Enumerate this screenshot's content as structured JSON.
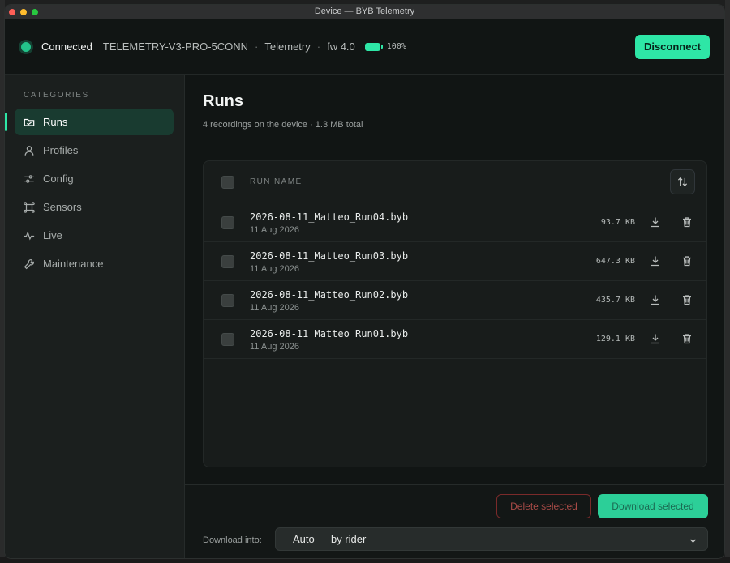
{
  "window": {
    "title": "Device — BYB Telemetry"
  },
  "header": {
    "status": "Connected",
    "device_name": "TELEMETRY-V3-PRO-5CONN",
    "separator": "·",
    "mode": "Telemetry",
    "firmware": "fw 4.0",
    "battery_percent": "100%",
    "battery_level": 1.0,
    "disconnect_label": "Disconnect"
  },
  "sidebar": {
    "heading": "CATEGORIES",
    "items": [
      {
        "label": "Runs",
        "icon": "folder-icon",
        "active": true
      },
      {
        "label": "Profiles",
        "icon": "user-icon",
        "active": false
      },
      {
        "label": "Config",
        "icon": "sliders-icon",
        "active": false
      },
      {
        "label": "Sensors",
        "icon": "sensors-icon",
        "active": false
      },
      {
        "label": "Live",
        "icon": "pulse-icon",
        "active": false
      },
      {
        "label": "Maintenance",
        "icon": "wrench-icon",
        "active": false
      }
    ]
  },
  "main": {
    "title": "Runs",
    "subtitle": "4 recordings on the device · 1.3 MB total",
    "table": {
      "column_name": "RUN NAME",
      "rows": [
        {
          "name": "2026-08-11_Matteo_Run04.byb",
          "date": "11 Aug 2026",
          "size": "93.7 KB"
        },
        {
          "name": "2026-08-11_Matteo_Run03.byb",
          "date": "11 Aug 2026",
          "size": "647.3 KB"
        },
        {
          "name": "2026-08-11_Matteo_Run02.byb",
          "date": "11 Aug 2026",
          "size": "435.7 KB"
        },
        {
          "name": "2026-08-11_Matteo_Run01.byb",
          "date": "11 Aug 2026",
          "size": "129.1 KB"
        }
      ]
    }
  },
  "footer": {
    "delete_label": "Delete selected",
    "download_label": "Download selected",
    "download_into_label": "Download into:",
    "download_into_value": "Auto — by rider"
  },
  "colors": {
    "accent": "#2ee6a6",
    "status": "#23c38a",
    "danger": "#a94b47"
  }
}
